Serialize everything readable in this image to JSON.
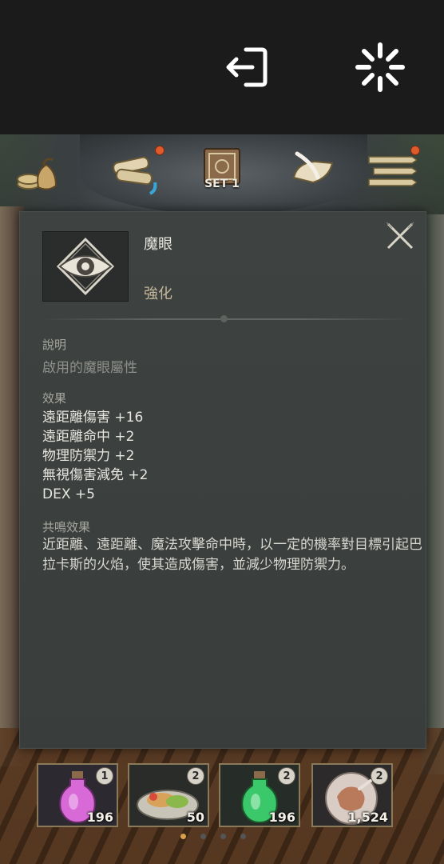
{
  "system_bar": {
    "exit_icon": "exit-icon",
    "loading_icon": "loading-spinner-icon"
  },
  "hud": {
    "items": [
      {
        "icon": "coin-bag-icon",
        "has_alert": false
      },
      {
        "icon": "scroll-bundle-icon",
        "has_alert": true
      },
      {
        "icon": "skill-book-icon",
        "label": "SET 1",
        "has_alert": false
      },
      {
        "icon": "quill-scroll-icon",
        "has_alert": false
      },
      {
        "icon": "menu-icon",
        "has_alert": true
      }
    ],
    "set_label": "SET 1"
  },
  "tooltip": {
    "skill_icon": "eye-icon",
    "name": "魔眼",
    "type": "強化",
    "description_heading": "說明",
    "description": "啟用的魔眼屬性",
    "effects_heading": "效果",
    "effects": [
      "遠距離傷害 +16",
      "遠距離命中 +2",
      "物理防禦力 +2",
      "無視傷害減免 +2",
      "DEX +5"
    ],
    "resonance_heading": "共鳴效果",
    "resonance_text": "近距離、遠距離、魔法攻擊命中時，以一定的機率對目標引起巴拉卡斯的火焰，使其造成傷害，並減少物理防禦力。"
  },
  "slots": [
    {
      "icon": "pink-potion-icon",
      "badge": "1",
      "count": "196"
    },
    {
      "icon": "food-plate-icon",
      "badge": "2",
      "count": "50"
    },
    {
      "icon": "green-potion-icon",
      "badge": "2",
      "count": "196"
    },
    {
      "icon": "meat-plate-icon",
      "badge": "2",
      "count": "1,524"
    }
  ],
  "colors": {
    "panel_bg": "#3a3e3c",
    "effect_text": "#e8e6e0",
    "type_text": "#c5b89c",
    "alert_dot": "#e05a2a",
    "active_page_dot": "#d9a24a"
  }
}
